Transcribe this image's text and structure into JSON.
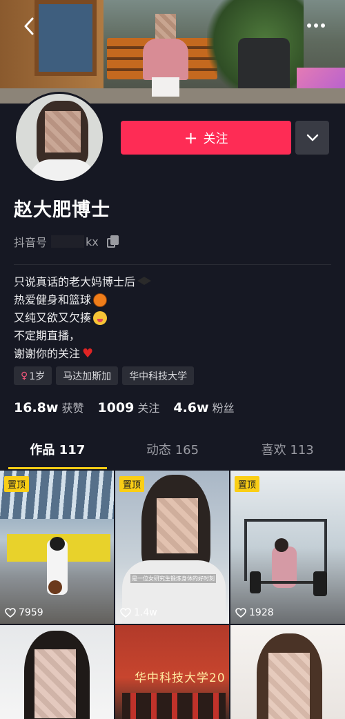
{
  "profile": {
    "name": "赵大肥博士",
    "douyin_id_label": "抖音号",
    "douyin_id_visible": "kx",
    "follow_label": "关注",
    "bio": [
      "只说真话的老大妈博士后",
      "热爱健身和篮球",
      "又纯又欲又欠揍",
      "不定期直播，",
      "谢谢你的关注"
    ],
    "tags": {
      "age": "1岁",
      "location": "马达加斯加",
      "school": "华中科技大学"
    },
    "stats": {
      "likes_num": "16.8w",
      "likes_label": "获赞",
      "following_num": "1009",
      "following_label": "关注",
      "followers_num": "4.6w",
      "followers_label": "粉丝"
    }
  },
  "tabs": [
    {
      "label": "作品 117",
      "active": true
    },
    {
      "label": "动态 165",
      "active": false
    },
    {
      "label": "喜欢 113",
      "active": false
    }
  ],
  "videos": [
    {
      "pinned": true,
      "pin_label": "置顶",
      "likes": "7959"
    },
    {
      "pinned": true,
      "pin_label": "置顶",
      "likes": "1.4w",
      "caption": "是一位女研究生锻炼身体的好时刻"
    },
    {
      "pinned": true,
      "pin_label": "置顶",
      "likes": "1928"
    },
    {
      "pinned": false
    },
    {
      "pinned": false,
      "banner": "华中科技大学20"
    },
    {
      "pinned": false
    }
  ],
  "colors": {
    "background": "#161823",
    "follow_button": "#fe2c55",
    "tab_indicator": "#face15",
    "pin_badge": "#face15"
  },
  "icons": {
    "back": "chevron-left-icon",
    "more": "more-dots-icon",
    "dropdown": "chevron-down-icon",
    "copy": "copy-icon",
    "like": "heart-outline-icon"
  }
}
